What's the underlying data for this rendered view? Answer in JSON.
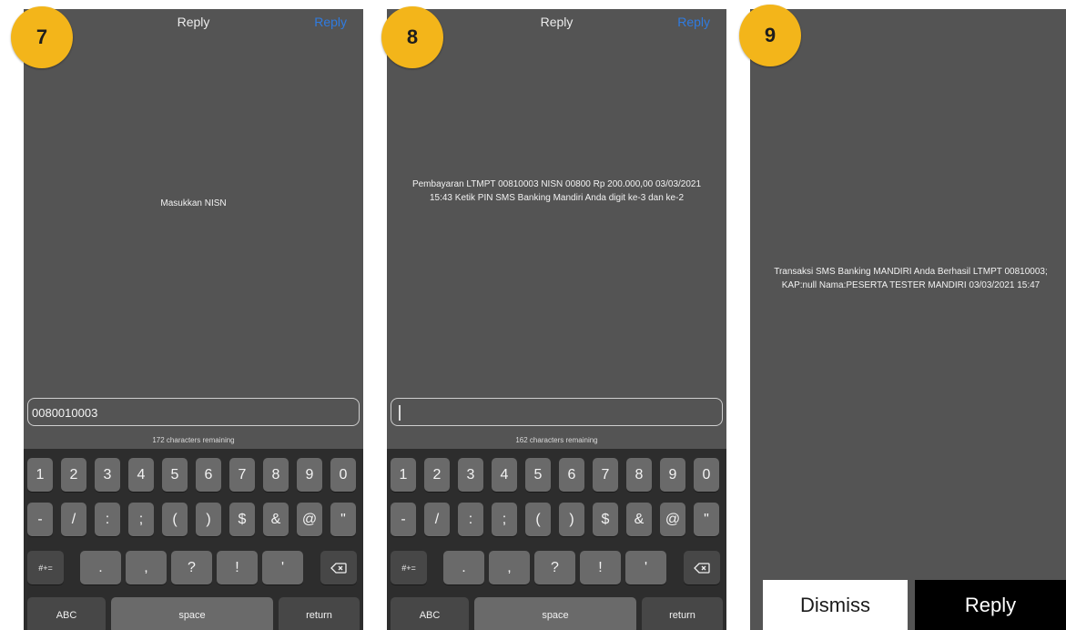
{
  "steps": [
    "7",
    "8",
    "9"
  ],
  "screens": [
    {
      "nav_title": "Reply",
      "nav_action": "Reply",
      "message": "Masukkan NISN",
      "input_value": "0080010003",
      "chars_remaining": "172 characters remaining"
    },
    {
      "nav_title": "Reply",
      "nav_action": "Reply",
      "message": "Pembayaran LTMPT 00810003 NISN      00800 Rp 200.000,00 03/03/2021 15:43 Ketik PIN SMS Banking Mandiri Anda digit ke-3 dan ke-2",
      "input_value": "",
      "chars_remaining": "162 characters remaining"
    },
    {
      "message": "Transaksi SMS Banking MANDIRI Anda Berhasil LTMPT 00810003; KAP:null Nama:PESERTA TESTER MANDIRI 03/03/2021 15:47",
      "dismiss_label": "Dismiss",
      "reply_label": "Reply"
    }
  ],
  "keyboard": {
    "row1": [
      "1",
      "2",
      "3",
      "4",
      "5",
      "6",
      "7",
      "8",
      "9",
      "0"
    ],
    "row2": [
      "-",
      "/",
      ":",
      ";",
      "(",
      ")",
      "$",
      "&",
      "@",
      "\""
    ],
    "row3": [
      ".",
      ",",
      "?",
      "!",
      "'"
    ],
    "symbols_key": "#+=",
    "abc_key": "ABC",
    "space_key": "space",
    "return_key": "return",
    "backspace_icon": "backspace-icon"
  },
  "colors": {
    "badge": "#f3b51a",
    "panel_bg": "#545454",
    "keyboard_bg": "#2d2d2d",
    "link_blue": "#2f7be0"
  }
}
